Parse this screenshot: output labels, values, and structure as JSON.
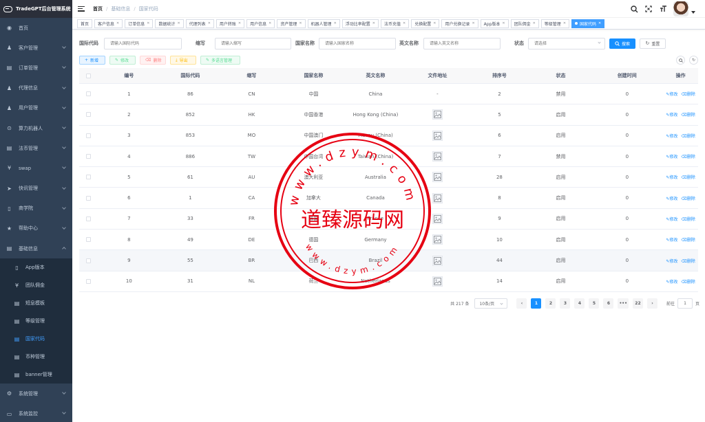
{
  "app": {
    "title": "TradeGPT后台管理系统"
  },
  "sidebar": {
    "items": [
      {
        "label": "首页",
        "icon": "dashboard-icon",
        "glyph": "◉",
        "has_children": false
      },
      {
        "label": "客户管理",
        "icon": "user-icon",
        "glyph": "♟",
        "has_children": true
      },
      {
        "label": "订单管理",
        "icon": "order-icon",
        "glyph": "▤",
        "has_children": true
      },
      {
        "label": "代理信息",
        "icon": "agent-icon",
        "glyph": "♟",
        "has_children": true
      },
      {
        "label": "用户管理",
        "icon": "people-icon",
        "glyph": "♟",
        "has_children": true
      },
      {
        "label": "算力机器人",
        "icon": "robot-icon",
        "glyph": "⊙",
        "has_children": true
      },
      {
        "label": "法币管理",
        "icon": "fiat-icon",
        "glyph": "▤",
        "has_children": true
      },
      {
        "label": "swap",
        "icon": "swap-icon",
        "glyph": "¥",
        "has_children": true
      },
      {
        "label": "快讯管理",
        "icon": "news-icon",
        "glyph": "➤",
        "has_children": true
      },
      {
        "label": "商学院",
        "icon": "book-icon",
        "glyph": "▯",
        "has_children": true
      },
      {
        "label": "帮助中心",
        "icon": "star-icon",
        "glyph": "★",
        "has_children": true
      },
      {
        "label": "基础信息",
        "icon": "basic-info-icon",
        "glyph": "▤",
        "has_children": true,
        "expanded": true
      }
    ],
    "submenu": [
      {
        "label": "App版本",
        "icon": "phone-icon",
        "glyph": "▯",
        "active": false
      },
      {
        "label": "团队佣金",
        "icon": "yen-icon",
        "glyph": "¥",
        "active": false
      },
      {
        "label": "短息模板",
        "icon": "sms-icon",
        "glyph": "▤",
        "active": false
      },
      {
        "label": "等级管理",
        "icon": "level-icon",
        "glyph": "▤",
        "active": false
      },
      {
        "label": "国家代码",
        "icon": "country-icon",
        "glyph": "▤",
        "active": true
      },
      {
        "label": "币种管理",
        "icon": "currency-icon",
        "glyph": "▤",
        "active": false
      },
      {
        "label": "banner管理",
        "icon": "banner-icon",
        "glyph": "▤",
        "active": false
      }
    ],
    "bottom_items": [
      {
        "label": "系统管理",
        "icon": "gear-icon",
        "glyph": "⚙",
        "has_children": true
      },
      {
        "label": "系统监控",
        "icon": "monitor-icon",
        "glyph": "▭",
        "has_children": true
      }
    ]
  },
  "breadcrumb": [
    "首页",
    "基础信息",
    "国家代码"
  ],
  "tags": [
    {
      "label": "首页",
      "closable": false,
      "active": false
    },
    {
      "label": "客户信息",
      "closable": true,
      "active": false
    },
    {
      "label": "订单信息",
      "closable": true,
      "active": false
    },
    {
      "label": "数据统计",
      "closable": true,
      "active": false
    },
    {
      "label": "代理列表",
      "closable": true,
      "active": false
    },
    {
      "label": "用户转账",
      "closable": true,
      "active": false
    },
    {
      "label": "用户信息",
      "closable": true,
      "active": false
    },
    {
      "label": "资产管理",
      "closable": true,
      "active": false
    },
    {
      "label": "机器人管理",
      "closable": true,
      "active": false
    },
    {
      "label": "浮动比率配置",
      "closable": true,
      "active": false
    },
    {
      "label": "法币充值",
      "closable": true,
      "active": false
    },
    {
      "label": "兑换配置",
      "closable": true,
      "active": false
    },
    {
      "label": "用户兑换记录",
      "closable": true,
      "active": false
    },
    {
      "label": "App版本",
      "closable": true,
      "active": false
    },
    {
      "label": "团队佣金",
      "closable": true,
      "active": false
    },
    {
      "label": "等级管理",
      "closable": true,
      "active": false
    },
    {
      "label": "国家代码",
      "closable": true,
      "active": true
    }
  ],
  "search": {
    "intl_code": {
      "label": "国际代码",
      "placeholder": "请输入国际代码"
    },
    "abbr": {
      "label": "缩写",
      "placeholder": "请输入缩写"
    },
    "country_name": {
      "label": "国家名称",
      "placeholder": "请输入国家名称"
    },
    "english_name": {
      "label": "英文名称",
      "placeholder": "请输入英文名称"
    },
    "status": {
      "label": "状态",
      "placeholder": "请选择"
    },
    "search_btn": "搜索",
    "reset_btn": "重置"
  },
  "toolbar": {
    "add": "新增",
    "edit": "修改",
    "delete": "删除",
    "export": "导出",
    "multilang": "多语言管理"
  },
  "table": {
    "headers": [
      "编号",
      "国际代码",
      "缩写",
      "国家名称",
      "英文名称",
      "文件地址",
      "排序号",
      "状态",
      "创建时间",
      "操作"
    ],
    "edit_label": "修改",
    "delete_label": "删除",
    "rows": [
      {
        "id": "1",
        "code": "86",
        "abbr": "CN",
        "name": "中国",
        "en": "China",
        "has_file": false,
        "file": "-",
        "sort": "2",
        "status": "禁用",
        "created": "0"
      },
      {
        "id": "2",
        "code": "852",
        "abbr": "HK",
        "name": "中国香港",
        "en": "Hong Kong (China)",
        "has_file": true,
        "file": "",
        "sort": "5",
        "status": "启用",
        "created": "0"
      },
      {
        "id": "3",
        "code": "853",
        "abbr": "MO",
        "name": "中国澳门",
        "en": "Macau (China)",
        "has_file": true,
        "file": "",
        "sort": "6",
        "status": "启用",
        "created": "0"
      },
      {
        "id": "4",
        "code": "886",
        "abbr": "TW",
        "name": "中国台湾",
        "en": "Taiwan (China)",
        "has_file": true,
        "file": "",
        "sort": "7",
        "status": "禁用",
        "created": "0"
      },
      {
        "id": "5",
        "code": "61",
        "abbr": "AU",
        "name": "澳大利亚",
        "en": "Australia",
        "has_file": true,
        "file": "",
        "sort": "28",
        "status": "启用",
        "created": "0"
      },
      {
        "id": "6",
        "code": "1",
        "abbr": "CA",
        "name": "加拿大",
        "en": "Canada",
        "has_file": true,
        "file": "",
        "sort": "8",
        "status": "启用",
        "created": "0"
      },
      {
        "id": "7",
        "code": "33",
        "abbr": "FR",
        "name": "法国",
        "en": "France",
        "has_file": true,
        "file": "",
        "sort": "9",
        "status": "启用",
        "created": "0"
      },
      {
        "id": "8",
        "code": "49",
        "abbr": "DE",
        "name": "德国",
        "en": "Germany",
        "has_file": true,
        "file": "",
        "sort": "10",
        "status": "启用",
        "created": "0"
      },
      {
        "id": "9",
        "code": "55",
        "abbr": "BR",
        "name": "巴西",
        "en": "Brazil",
        "has_file": true,
        "file": "",
        "sort": "44",
        "status": "启用",
        "created": "0"
      },
      {
        "id": "10",
        "code": "31",
        "abbr": "NL",
        "name": "荷兰",
        "en": "Netherlands",
        "has_file": true,
        "file": "",
        "sort": "14",
        "status": "启用",
        "created": "0"
      }
    ]
  },
  "pagination": {
    "total": "共 217 条",
    "page_size": "10条/页",
    "pages": [
      "1",
      "2",
      "3",
      "4",
      "5",
      "6",
      "•••",
      "22"
    ],
    "current": "1",
    "goto_label": "前往",
    "goto_value": "1",
    "page_suffix": "页"
  },
  "watermark": {
    "text": "道臻源码网",
    "url_text": "www.dzym.com"
  },
  "colors": {
    "sidebar_bg": "#304156",
    "primary": "#1890ff",
    "active_menu": "#409eff",
    "stamp_red": "#e60012"
  }
}
